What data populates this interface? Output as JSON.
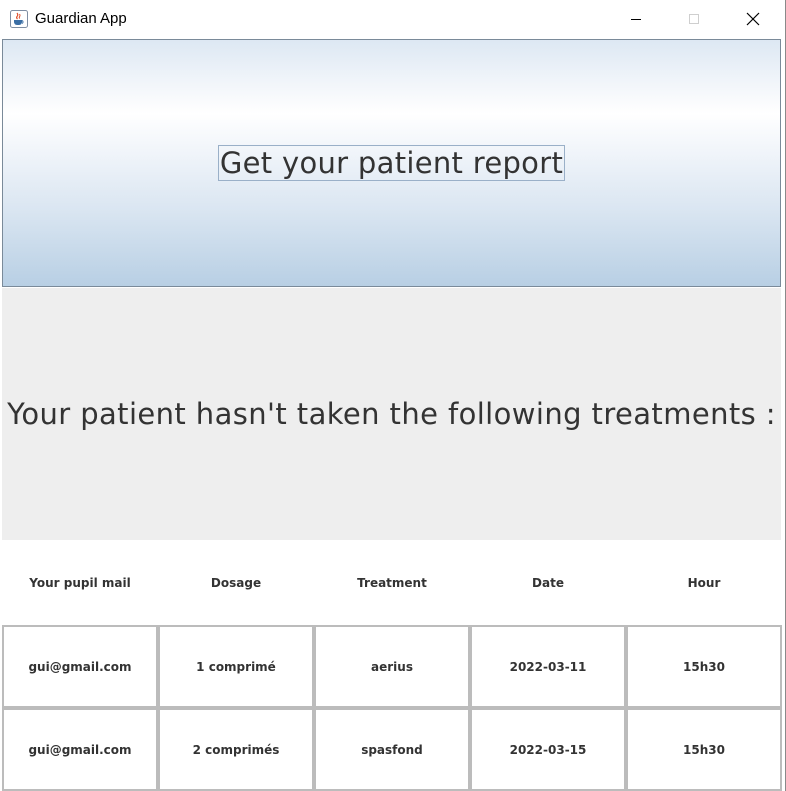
{
  "window": {
    "title": "Guardian App",
    "icon": "java-cup-icon"
  },
  "report_button": {
    "label": "Get your patient report"
  },
  "message": {
    "text": "Your patient hasn't taken the following treatments :"
  },
  "table": {
    "headers": [
      "Your pupil mail",
      "Dosage",
      "Treatment",
      "Date",
      "Hour"
    ],
    "rows": [
      [
        "gui@gmail.com",
        "1 comprimé",
        "aerius",
        "2022-03-11",
        "15h30"
      ],
      [
        "gui@gmail.com",
        "2 comprimés",
        "spasfond",
        "2022-03-15",
        "15h30"
      ]
    ]
  },
  "colors": {
    "message_panel_bg": "#eeeeee",
    "cell_border": "#bcbcbc",
    "text": "#333333"
  }
}
